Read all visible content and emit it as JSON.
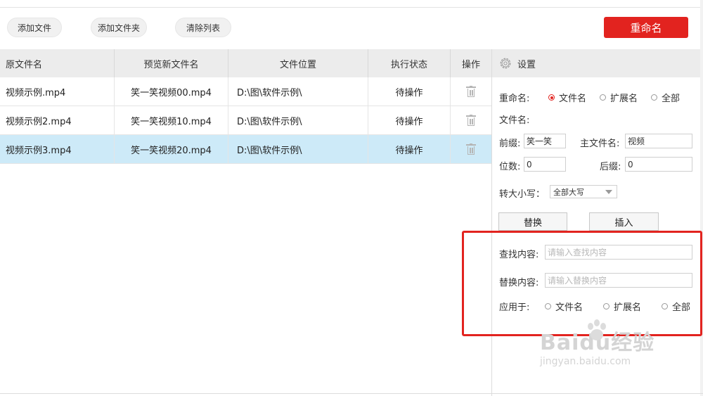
{
  "toolbar": {
    "add_file": "添加文件",
    "add_folder": "添加文件夹",
    "clear_list": "清除列表",
    "rename": "重命名"
  },
  "table": {
    "headers": [
      "原文件名",
      "预览新文件名",
      "文件位置",
      "执行状态",
      "操作"
    ],
    "rows": [
      {
        "original": "视频示例.mp4",
        "preview": "笑一笑视频00.mp4",
        "location": "D:\\图\\软件示例\\",
        "status": "待操作"
      },
      {
        "original": "视频示例2.mp4",
        "preview": "笑一笑视频10.mp4",
        "location": "D:\\图\\软件示例\\",
        "status": "待操作"
      },
      {
        "original": "视频示例3.mp4",
        "preview": "笑一笑视频20.mp4",
        "location": "D:\\图\\软件示例\\",
        "status": "待操作"
      }
    ],
    "selected_row": 2
  },
  "settings": {
    "title": "设置",
    "rename_label": "重命名:",
    "rename_options": [
      "文件名",
      "扩展名",
      "全部"
    ],
    "rename_selected": "文件名",
    "filename_label": "文件名:",
    "prefix_label": "前缀:",
    "prefix_value": "笑一笑",
    "main_name_label": "主文件名:",
    "main_name_value": "视频",
    "digits_label": "位数:",
    "digits_value": "0",
    "suffix_label": "后缀:",
    "suffix_value": "0",
    "case_label": "转大小写：",
    "case_value": "全部大写",
    "replace_button": "替换",
    "insert_button": "插入",
    "find_label": "查找内容:",
    "find_placeholder": "请输入查找内容",
    "replace_label": "替换内容:",
    "replace_placeholder": "请输入替换内容",
    "apply_label": "应用于:",
    "apply_options": [
      "文件名",
      "扩展名",
      "全部"
    ]
  },
  "watermark": {
    "main": "Baidu经验",
    "sub": "jingyan.baidu.com"
  },
  "colors": {
    "accent": "#e2231f",
    "selected_row": "#cdeaf8",
    "header_bg": "#ececec"
  }
}
